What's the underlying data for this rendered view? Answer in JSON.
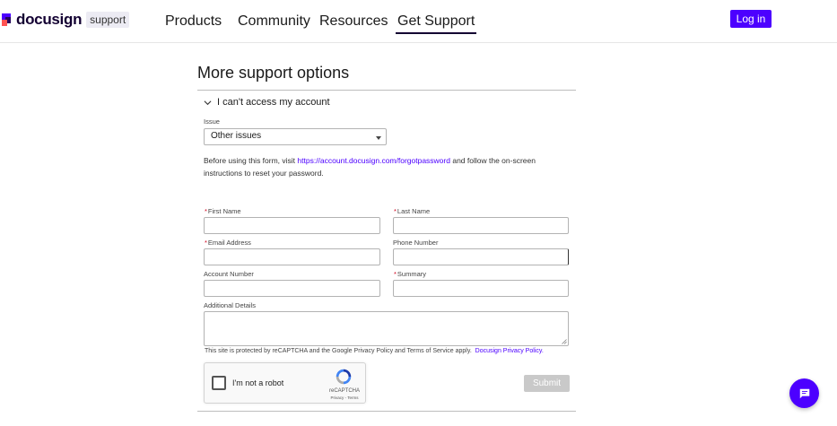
{
  "header": {
    "logo_text": "docusign",
    "logo_badge": "support",
    "nav": [
      {
        "label": "Products"
      },
      {
        "label": "Community"
      },
      {
        "label": "Resources"
      },
      {
        "label": "Get Support"
      }
    ],
    "login_label": "Log in"
  },
  "main": {
    "section_title": "More support options",
    "accordion_label": "I can't access my account",
    "issue_label": "Issue",
    "issue_value": "Other issues",
    "info_before": "Before using this form, visit ",
    "info_link": "https://account.docusign.com/forgotpassword",
    "info_after": " and follow the on-screen instructions to reset your password.",
    "form": {
      "first_name_label": "First Name",
      "last_name_label": "Last Name",
      "email_label": "Email Address",
      "phone_label": "Phone Number",
      "account_label": "Account Number",
      "summary_label": "Summary",
      "details_label": "Additional Details",
      "required_mark": "*"
    },
    "recaptcha_note": "This site is protected by reCAPTCHA and the Google Privacy Policy and Terms of Service apply.",
    "privacy_link": "Docusign Privacy Policy.",
    "recaptcha": {
      "checkbox_label": "I'm not a robot",
      "brand": "reCAPTCHA",
      "links": "Privacy - Terms"
    },
    "submit_label": "Submit"
  },
  "colors": {
    "brand_purple": "#4c00ff",
    "required_red": "#d0021b",
    "submit_disabled": "#c9c9c9"
  },
  "icons": {
    "accordion": "chevron-down-icon",
    "chat": "chat-icon",
    "recaptcha": "recaptcha-logo-icon"
  }
}
